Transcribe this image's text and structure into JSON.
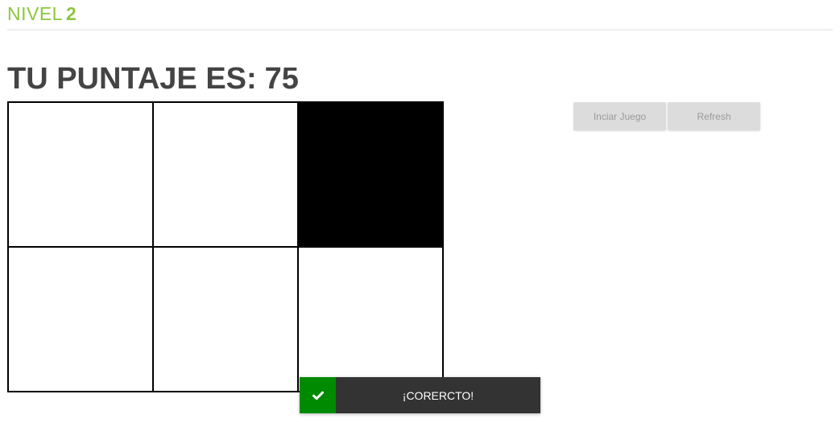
{
  "header": {
    "level_label": "NIVEL",
    "level_number": "2",
    "accent_color": "#8dc63f"
  },
  "score": {
    "label": "TU PUNTAJE ES:",
    "value": "75"
  },
  "board": {
    "rows": 2,
    "columns": 3,
    "cells": [
      [
        false,
        false,
        true
      ],
      [
        false,
        false,
        false
      ]
    ]
  },
  "controls": {
    "start_label": "Inciar Juego",
    "refresh_label": "Refresh"
  },
  "toast": {
    "icon": "check-icon",
    "message": "¡CORERCTO!",
    "icon_bg_color": "#008a00",
    "bg_color": "#333333"
  }
}
